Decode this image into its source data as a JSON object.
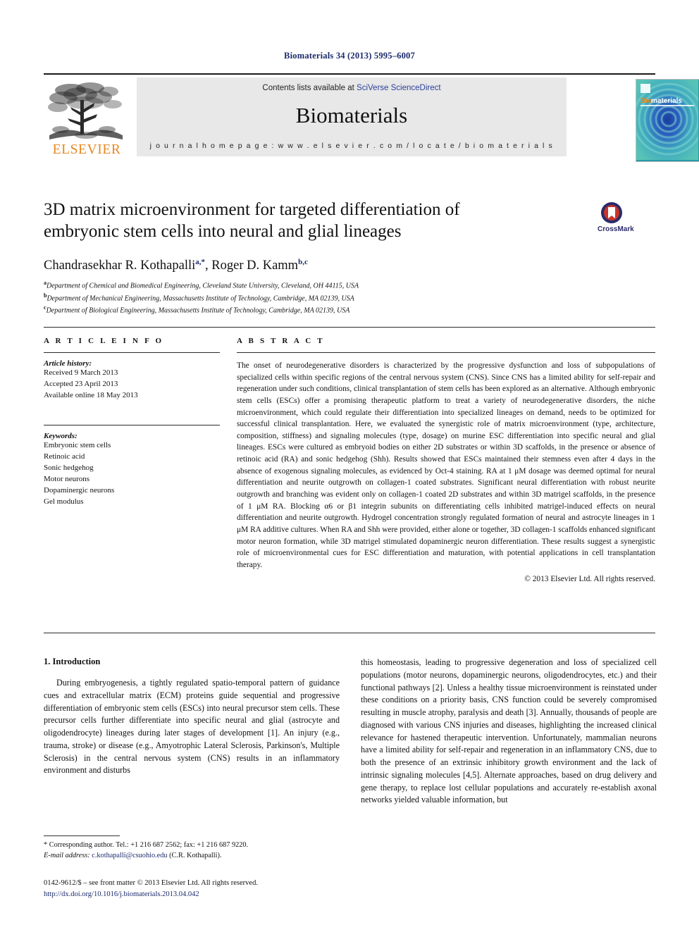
{
  "running_head": "Biomaterials 34 (2013) 5995–6007",
  "masthead": {
    "contents_prefix": "Contents lists available at ",
    "contents_link": "SciVerse ScienceDirect",
    "journal_name": "Biomaterials",
    "homepage": "j o u r n a l   h o m e p a g e :   w w w . e l s e v i e r . c o m / l o c a t e / b i o m a t e r i a l s",
    "publisher": "ELSEVIER",
    "cover_title_a": "Bio",
    "cover_title_b": "materials"
  },
  "article": {
    "title": "3D matrix microenvironment for targeted differentiation of embryonic stem cells into neural and glial lineages",
    "authors_1": "Chandrasekhar R. Kothapalli",
    "authors_1_sup": "a,*",
    "authors_sep": ", ",
    "authors_2": "Roger D. Kamm",
    "authors_2_sup": "b,c",
    "affiliations": [
      {
        "mark": "a",
        "text": "Department of Chemical and Biomedical Engineering, Cleveland State University, Cleveland, OH 44115, USA"
      },
      {
        "mark": "b",
        "text": "Department of Mechanical Engineering, Massachusetts Institute of Technology, Cambridge, MA 02139, USA"
      },
      {
        "mark": "c",
        "text": "Department of Biological Engineering, Massachusetts Institute of Technology, Cambridge, MA 02139, USA"
      }
    ],
    "crossmark_label": "CrossMark"
  },
  "article_info": {
    "heading": "A R T I C L E   I N F O",
    "history_label": "Article history:",
    "history": [
      "Received 9 March 2013",
      "Accepted 23 April 2013",
      "Available online 18 May 2013"
    ],
    "keywords_label": "Keywords:",
    "keywords": [
      "Embryonic stem cells",
      "Retinoic acid",
      "Sonic hedgehog",
      "Motor neurons",
      "Dopaminergic neurons",
      "Gel modulus"
    ]
  },
  "abstract": {
    "heading": "A B S T R A C T",
    "text": "The onset of neurodegenerative disorders is characterized by the progressive dysfunction and loss of subpopulations of specialized cells within specific regions of the central nervous system (CNS). Since CNS has a limited ability for self-repair and regeneration under such conditions, clinical transplantation of stem cells has been explored as an alternative. Although embryonic stem cells (ESCs) offer a promising therapeutic platform to treat a variety of neurodegenerative disorders, the niche microenvironment, which could regulate their differentiation into specialized lineages on demand, needs to be optimized for successful clinical transplantation. Here, we evaluated the synergistic role of matrix microenvironment (type, architecture, composition, stiffness) and signaling molecules (type, dosage) on murine ESC differentiation into specific neural and glial lineages. ESCs were cultured as embryoid bodies on either 2D substrates or within 3D scaffolds, in the presence or absence of retinoic acid (RA) and sonic hedgehog (Shh). Results showed that ESCs maintained their stemness even after 4 days in the absence of exogenous signaling molecules, as evidenced by Oct-4 staining. RA at 1 μM dosage was deemed optimal for neural differentiation and neurite outgrowth on collagen-1 coated substrates. Significant neural differentiation with robust neurite outgrowth and branching was evident only on collagen-1 coated 2D substrates and within 3D matrigel scaffolds, in the presence of 1 μM RA. Blocking α6 or β1 integrin subunits on differentiating cells inhibited matrigel-induced effects on neural differentiation and neurite outgrowth. Hydrogel concentration strongly regulated formation of neural and astrocyte lineages in 1 μM RA additive cultures. When RA and Shh were provided, either alone or together, 3D collagen-1 scaffolds enhanced significant motor neuron formation, while 3D matrigel stimulated dopaminergic neuron differentiation. These results suggest a synergistic role of microenvironmental cues for ESC differentiation and maturation, with potential applications in cell transplantation therapy.",
    "copyright": "© 2013 Elsevier Ltd. All rights reserved."
  },
  "introduction": {
    "heading": "1.  Introduction",
    "left_paragraph": "During embryogenesis, a tightly regulated spatio-temporal pattern of guidance cues and extracellular matrix (ECM) proteins guide sequential and progressive differentiation of embryonic stem cells (ESCs) into neural precursor stem cells. These precursor cells further differentiate into specific neural and glial (astrocyte and oligodendrocyte) lineages during later stages of development [1]. An injury (e.g., trauma, stroke) or disease (e.g., Amyotrophic Lateral Sclerosis, Parkinson's, Multiple Sclerosis) in the central nervous system (CNS) results in an inflammatory environment and disturbs",
    "right_paragraph": "this homeostasis, leading to progressive degeneration and loss of specialized cell populations (motor neurons, dopaminergic neurons, oligodendrocytes, etc.) and their functional pathways [2]. Unless a healthy tissue microenvironment is reinstated under these conditions on a priority basis, CNS function could be severely compromised resulting in muscle atrophy, paralysis and death [3]. Annually, thousands of people are diagnosed with various CNS injuries and diseases, highlighting the increased clinical relevance for hastened therapeutic intervention. Unfortunately, mammalian neurons have a limited ability for self-repair and regeneration in an inflammatory CNS, due to both the presence of an extrinsic inhibitory growth environment and the lack of intrinsic signaling molecules [4,5]. Alternate approaches, based on drug delivery and gene therapy, to replace lost cellular populations and accurately re-establish axonal networks yielded valuable information, but"
  },
  "footnotes": {
    "corresponding": "* Corresponding author. Tel.: +1 216 687 2562; fax: +1 216 687 9220.",
    "email_label": "E-mail address:",
    "email": "c.kothapalli@csuohio.edu",
    "email_suffix": "(C.R. Kothapalli).",
    "issn_line": "0142-9612/$ – see front matter © 2013 Elsevier Ltd. All rights reserved.",
    "doi": "http://dx.doi.org/10.1016/j.biomaterials.2013.04.042"
  },
  "colors": {
    "link_blue": "#1b2a6b",
    "elsevier_orange": "#E8871E",
    "band_gray": "#e8e8e8",
    "cover_teal": "#2c9aa8"
  }
}
